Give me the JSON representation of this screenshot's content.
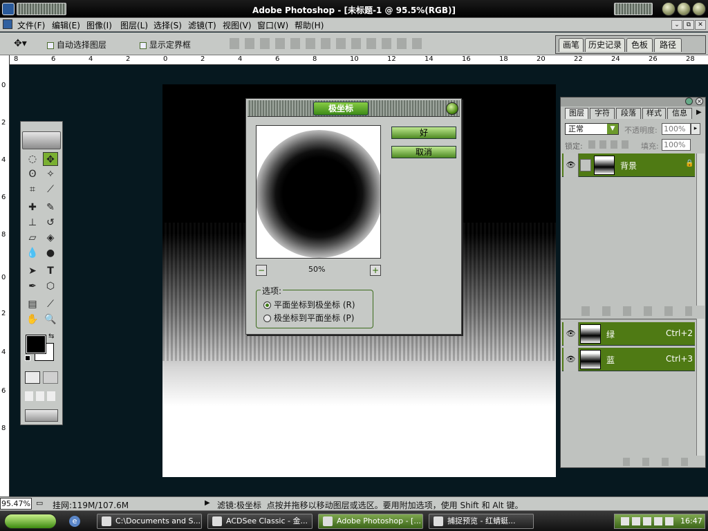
{
  "window": {
    "title": "Adobe Photoshop - [未标题-1 @ 95.5%(RGB)]"
  },
  "menu": [
    "文件(F)",
    "编辑(E)",
    "图像(I)",
    "图层(L)",
    "选择(S)",
    "滤镜(T)",
    "视图(V)",
    "窗口(W)",
    "帮助(H)"
  ],
  "options": {
    "auto_select": "自动选择图层",
    "show_bounds": "显示定界框"
  },
  "palette_well_tabs": [
    "画笔",
    "历史记录",
    "色板",
    "路径"
  ],
  "ruler_h": [
    "8",
    "6",
    "4",
    "2",
    "0",
    "2",
    "4",
    "6",
    "8",
    "10",
    "12",
    "14",
    "16",
    "18",
    "20",
    "22",
    "24",
    "26",
    "28"
  ],
  "ruler_v": [
    "0",
    "2",
    "4",
    "6",
    "8",
    "0",
    "2",
    "4",
    "6",
    "8"
  ],
  "dialog": {
    "title": "极坐标",
    "ok": "好",
    "cancel": "取消",
    "zoom": "50%",
    "options_label": "选项:",
    "opt1": "平面坐标到极坐标 (R)",
    "opt2": "极坐标到平面坐标 (P)",
    "opt1_selected": true
  },
  "layers_panel": {
    "tabs": [
      "图层",
      "字符",
      "段落",
      "样式",
      "信息"
    ],
    "blend_mode": "正常",
    "opacity_label": "不透明度:",
    "opacity": "100%",
    "lock_label": "锁定:",
    "fill_label": "填充:",
    "fill": "100%",
    "layer_name": "背景",
    "channels": [
      {
        "name": "绿",
        "shortcut": "Ctrl+2"
      },
      {
        "name": "蓝",
        "shortcut": "Ctrl+3"
      }
    ]
  },
  "status": {
    "zoom": "95.47%",
    "doc_size": "挂网:119M/107.6M",
    "hint": "滤镜:极坐标  点按并拖移以移动图层或选区。要用附加选项，使用 Shift 和 Alt 键。"
  },
  "taskbar": {
    "items": [
      "C:\\Documents and S...",
      "ACDSee Classic - 金...",
      "Adobe Photoshop - [...",
      "捕捉预览 - 红蜻蜓..."
    ],
    "active_index": 2,
    "clock": "16:47"
  },
  "colors": {
    "accent_green": "#4f7a14",
    "canvas_bg": "#06181f"
  }
}
